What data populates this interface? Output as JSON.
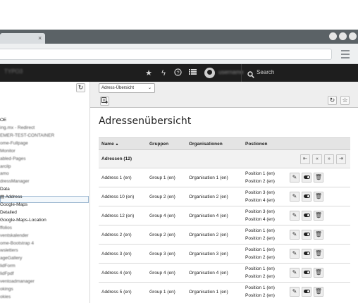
{
  "browser": {
    "tab_close": "×"
  },
  "topbar": {
    "logo_text": "TYPO3",
    "username": "username",
    "search_label": "Search",
    "icons": [
      "star-icon",
      "bolt-icon",
      "help-icon",
      "list-icon",
      "user-avatar-icon"
    ]
  },
  "docheader": {
    "select_value": "Adress-Übersicht",
    "select_caret": "⌄"
  },
  "tree": {
    "root_label": "OE",
    "items": [
      "ing.mx - Redirect",
      "EMER-TEST-CONTAINER",
      "ome-Fullpage",
      "Monitor",
      "abled-Pages",
      "arcilp",
      "amo",
      "dressManager",
      "Data",
      "Address",
      "Google-Maps",
      "Detailed",
      "Google-Maps-Location",
      "ffolios",
      "ventskalender",
      "ome-Bootstrap 4",
      "wsletters",
      "ageGallery",
      "lidForm",
      "lidFpdf",
      "ventoadmanager",
      "okings",
      "okies"
    ]
  },
  "main": {
    "title": "Adressenübersicht",
    "columns": [
      "Name",
      "Gruppen",
      "Organisationen",
      "Postionen"
    ],
    "sort_indicator": "▲",
    "group_label": "Adressen (12)",
    "rows": [
      {
        "name": "Address 1 (en)",
        "group": "Group 1 (en)",
        "org": "Organisation 1 (en)",
        "pos1": "Position 1 (en)",
        "pos2": "Position 2 (en)"
      },
      {
        "name": "Address 10 (en)",
        "group": "Group 2 (en)",
        "org": "Organisation 2 (en)",
        "pos1": "Position 3 (en)",
        "pos2": "Position 4 (en)"
      },
      {
        "name": "Address 12 (en)",
        "group": "Group 4 (en)",
        "org": "Organisation 4 (en)",
        "pos1": "Position 3 (en)",
        "pos2": "Position 4 (en)"
      },
      {
        "name": "Address 2 (en)",
        "group": "Group 2 (en)",
        "org": "Organisation 2 (en)",
        "pos1": "Position 1 (en)",
        "pos2": "Position 2 (en)"
      },
      {
        "name": "Address 3 (en)",
        "group": "Group 3 (en)",
        "org": "Organisation 3 (en)",
        "pos1": "Position 1 (en)",
        "pos2": "Position 2 (en)"
      },
      {
        "name": "Address 4 (en)",
        "group": "Group 4 (en)",
        "org": "Organisation 4 (en)",
        "pos1": "Position 1 (en)",
        "pos2": "Position 2 (en)"
      },
      {
        "name": "Address 5 (en)",
        "group": "Group 1 (en)",
        "org": "Organisation 1 (en)",
        "pos1": "Position 1 (en)",
        "pos2": "Position 2 (en)"
      }
    ],
    "pager": [
      "⇤",
      "«",
      "»",
      "⇥"
    ]
  }
}
